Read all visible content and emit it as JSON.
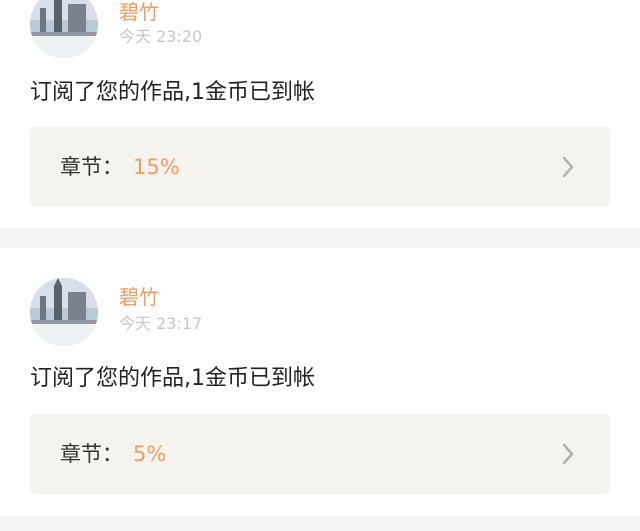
{
  "colors": {
    "accent": "#f39a61",
    "separator": "#f4f4f4",
    "chapter_box_bg": "#f4f3ee",
    "time_text": "#c7c7c7"
  },
  "notifications": [
    {
      "user_name": "碧竹",
      "time": "今天 23:20",
      "message": "订阅了您的作品,1金币已到帐",
      "chapter_label": "章节：",
      "chapter_value": "15%",
      "avatar_icon": "winter-building-avatar",
      "chevron_icon": "chevron-right-icon"
    },
    {
      "user_name": "碧竹",
      "time": "今天 23:17",
      "message": "订阅了您的作品,1金币已到帐",
      "chapter_label": "章节：",
      "chapter_value": "5%",
      "avatar_icon": "winter-building-avatar",
      "chevron_icon": "chevron-right-icon"
    }
  ]
}
